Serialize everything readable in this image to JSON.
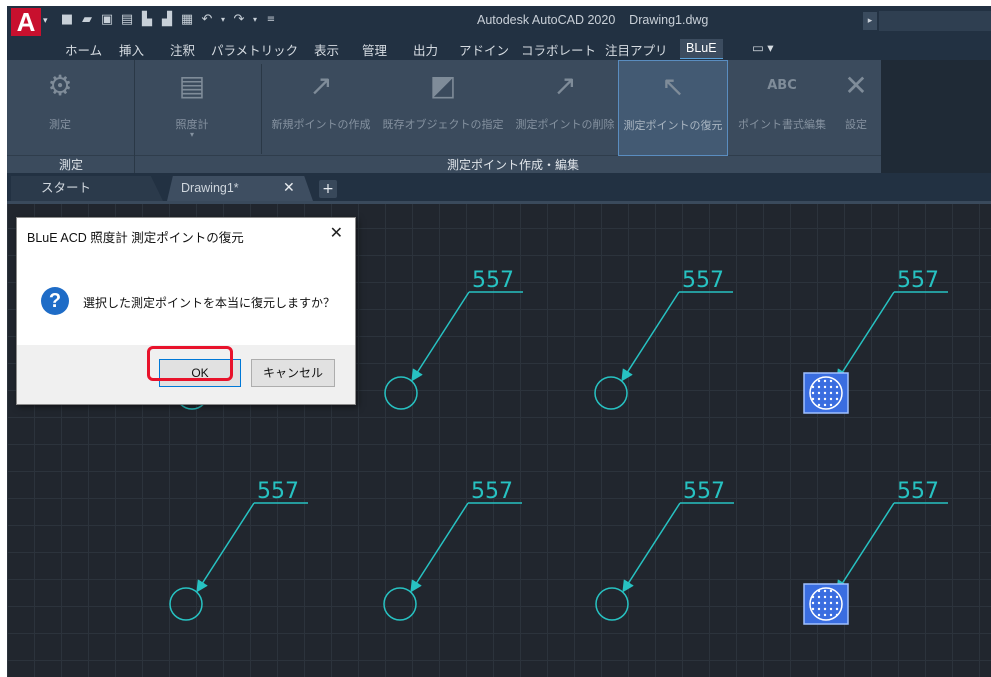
{
  "app": {
    "logo": "A",
    "title": "Autodesk AutoCAD 2020    Drawing1.dwg",
    "qat_icons": [
      "new-icon",
      "open-icon",
      "save-icon",
      "save-as-icon",
      "publish-icon",
      "share-icon",
      "print-icon",
      "undo-icon",
      "undo-dropdown-icon",
      "redo-icon",
      "redo-dropdown-icon",
      "customize-qat-icon"
    ]
  },
  "ribbon_tabs": [
    "ホーム",
    "挿入",
    "注釈",
    "パラメトリック",
    "表示",
    "管理",
    "出力",
    "アドイン",
    "コラボレート",
    "注目アプリ",
    "BLuE",
    "▭ ▾"
  ],
  "ribbon": {
    "panel1": {
      "title": "測定",
      "buttons": [
        {
          "label": "測定",
          "icon": "measure-icon"
        }
      ]
    },
    "panel2": {
      "title": "測定ポイント作成・編集",
      "buttons": [
        {
          "label": "照度計",
          "icon": "illuminance-meter-icon",
          "dropdown": "▾"
        },
        {
          "label": "新規ポイントの作成",
          "icon": "new-point-icon"
        },
        {
          "label": "既存オブジェクトの指定",
          "icon": "select-object-icon"
        },
        {
          "label": "測定ポイントの削除",
          "icon": "delete-point-icon"
        },
        {
          "label": "測定ポイントの復元",
          "icon": "restore-point-icon",
          "selected": true
        },
        {
          "label": "ポイント書式編集",
          "icon": "format-edit-icon",
          "icon_text": "ABC"
        },
        {
          "label": "設定",
          "icon": "settings-tools-icon"
        }
      ]
    }
  },
  "doc_tabs": {
    "start": "スタート",
    "drawing": "Drawing1*",
    "close": "✕",
    "new": "+"
  },
  "drawing": {
    "point_value": "557",
    "point_count": 8
  },
  "dialog": {
    "title": "BLuE ACD 照度計 測定ポイントの復元",
    "close": "✕",
    "icon": "?",
    "message": "選択した測定ポイントを本当に復元しますか？",
    "ok": "OK",
    "cancel": "キャンセル"
  },
  "colors": {
    "accent_cyan": "#27c2c2",
    "highlight_red": "#e8122b",
    "selected_point_blue": "#3a6de0"
  }
}
